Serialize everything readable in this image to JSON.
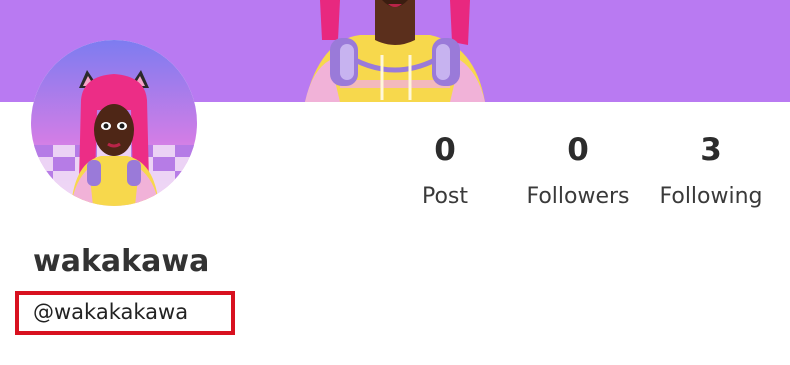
{
  "profile": {
    "display_name": "wakakawa",
    "handle": "@wakakakawa"
  },
  "stats": [
    {
      "number": "0",
      "label": "Post"
    },
    {
      "number": "0",
      "label": "Followers"
    },
    {
      "number": "3",
      "label": "Following"
    }
  ],
  "colors": {
    "cover": "#b97af2",
    "highlight_box": "#d8111f"
  }
}
